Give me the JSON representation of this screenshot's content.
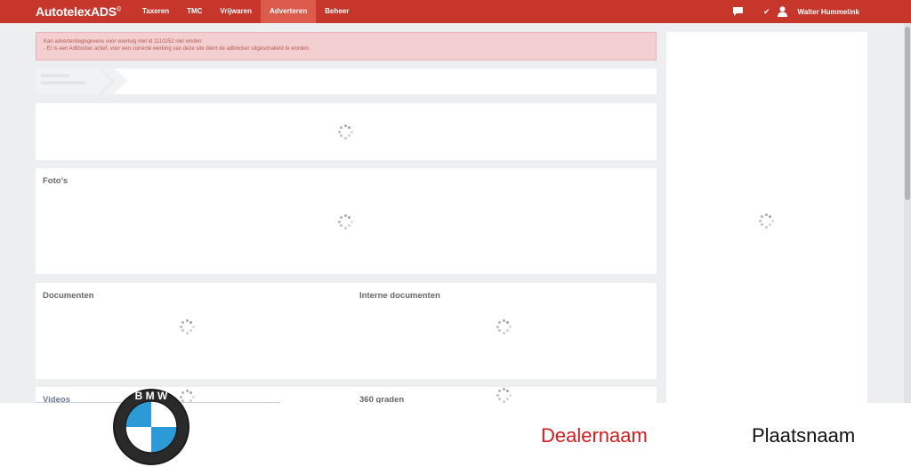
{
  "app": {
    "logo": "AutotelexADS",
    "logo_mark": "©"
  },
  "nav": {
    "items": [
      {
        "label": "Taxeren",
        "active": false
      },
      {
        "label": "TMC",
        "active": false
      },
      {
        "label": "Vrijwaren",
        "active": false
      },
      {
        "label": "Adverteren",
        "active": true
      },
      {
        "label": "Beheer",
        "active": false
      }
    ]
  },
  "user": {
    "name": "Walter Hummelink"
  },
  "alert": {
    "line1": "Kan advertentiegegevens voor voertuig met id 1110252 niet vinden:",
    "line2": "- Er is een Adblocker actief, voor een correcte werking van deze site dient de adblocker uitgeschakeld te worden."
  },
  "sections": {
    "photos_title": "Foto's",
    "documents_title": "Documenten",
    "internal_documents_title": "Interne documenten",
    "videos_title": "Videos",
    "degrees360_title": "360 graden"
  },
  "banner": {
    "brand_logo": "BMW",
    "dealer_name": "Dealernaam",
    "place_name": "Plaatsnaam"
  },
  "colors": {
    "brand_red": "#c6362b",
    "active_tab": "#dd5b4c",
    "alert_bg": "#f4cfd1",
    "alert_text": "#b5584f",
    "dealer_red": "#d21d1d"
  },
  "icons": {
    "chat": "chat-icon",
    "check": "check-icon",
    "user": "user-icon",
    "loader": "loading-spinner-icon"
  }
}
